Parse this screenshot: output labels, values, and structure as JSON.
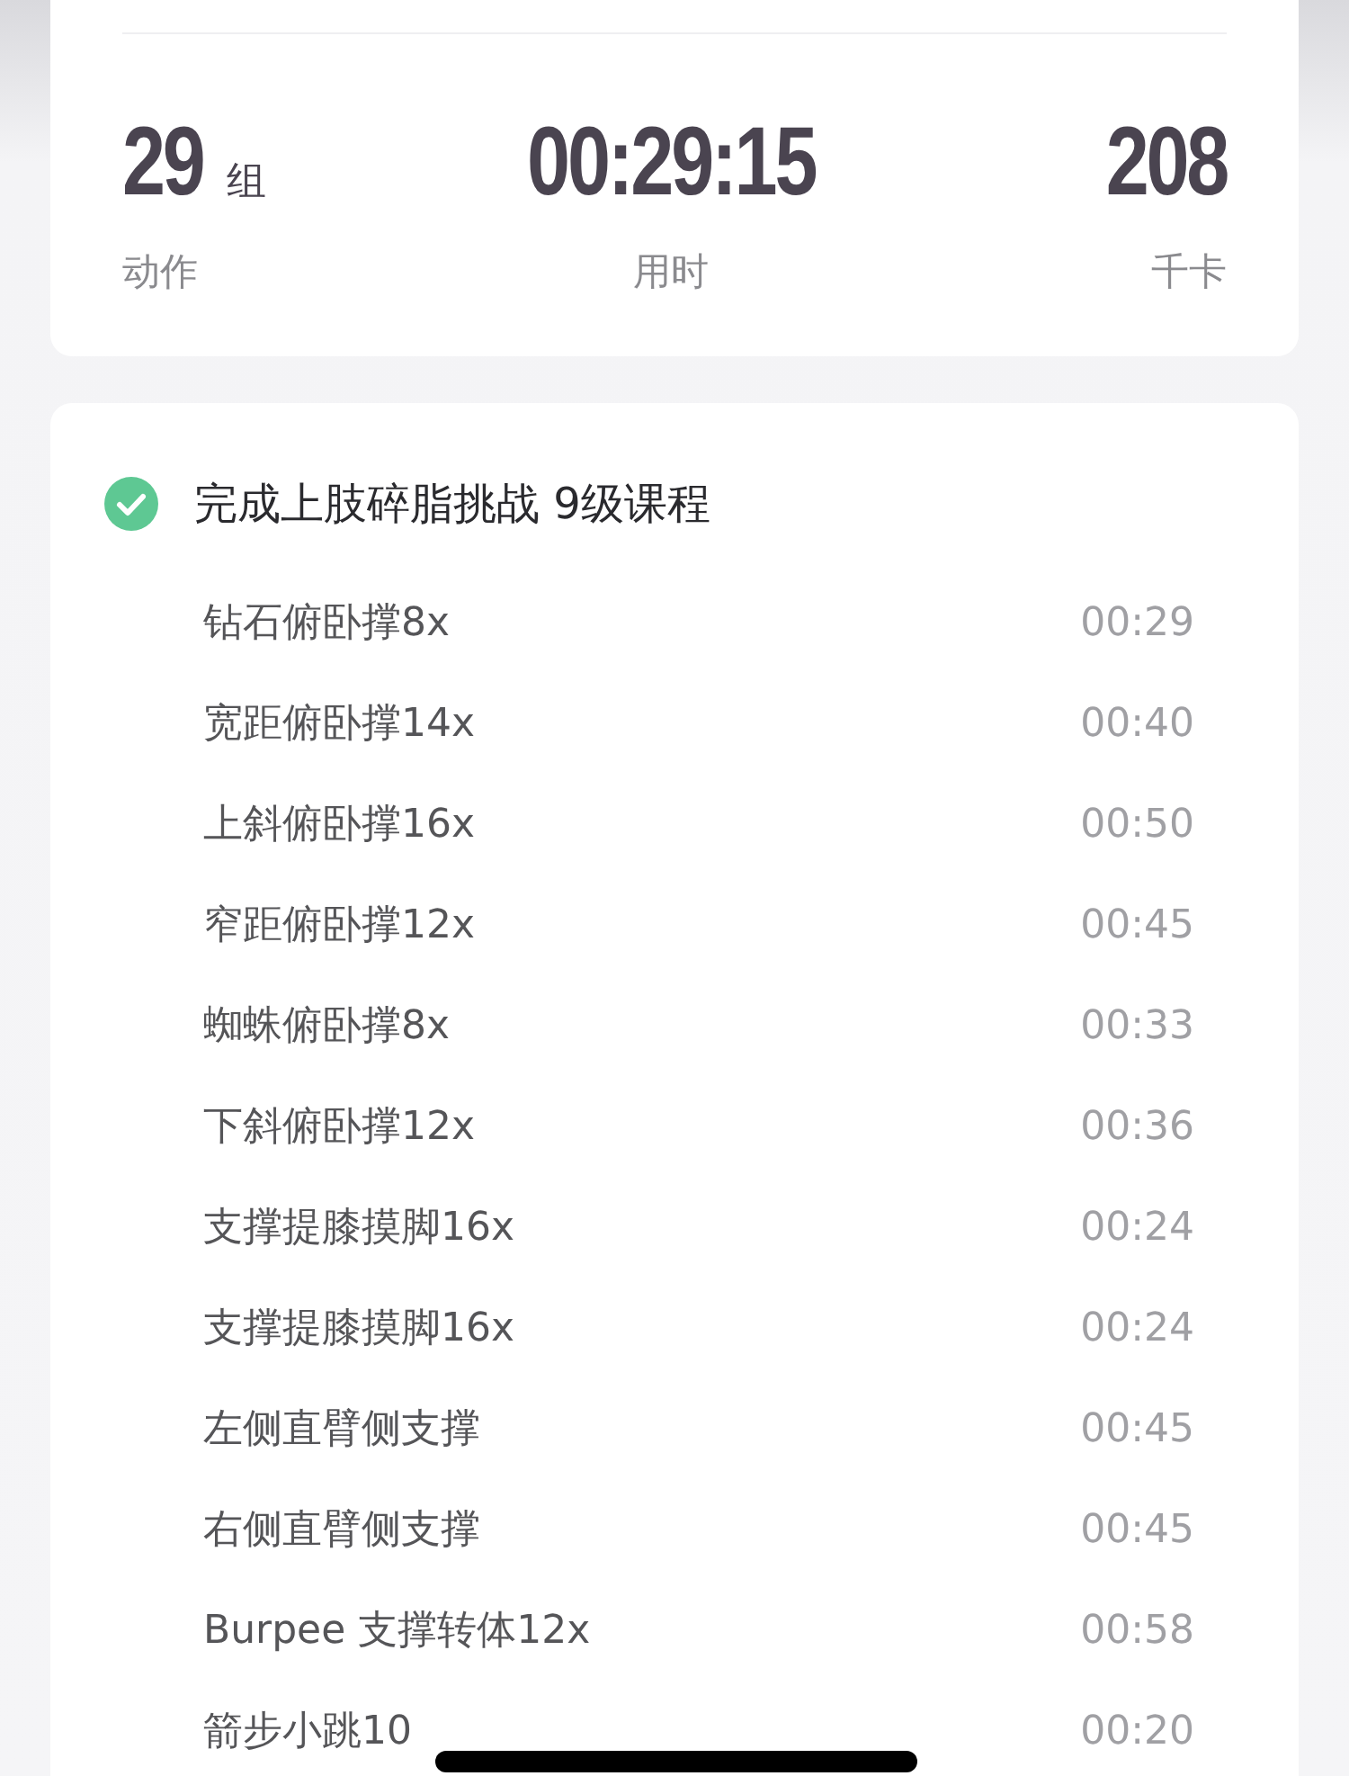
{
  "summary": {
    "stats": [
      {
        "value": "29",
        "unit": "组",
        "label": "动作"
      },
      {
        "value": "00:29:15",
        "label": "用时"
      },
      {
        "value": "208",
        "label": "千卡"
      }
    ]
  },
  "course": {
    "completed": true,
    "title": "完成上肢碎脂挑战 9级课程",
    "exercises": [
      {
        "name": "钻石俯卧撑8x",
        "time": "00:29"
      },
      {
        "name": "宽距俯卧撑14x",
        "time": "00:40"
      },
      {
        "name": "上斜俯卧撑16x",
        "time": "00:50"
      },
      {
        "name": "窄距俯卧撑12x",
        "time": "00:45"
      },
      {
        "name": "蜘蛛俯卧撑8x",
        "time": "00:33"
      },
      {
        "name": "下斜俯卧撑12x",
        "time": "00:36"
      },
      {
        "name": "支撑提膝摸脚16x",
        "time": "00:24"
      },
      {
        "name": "支撑提膝摸脚16x",
        "time": "00:24"
      },
      {
        "name": "左侧直臂侧支撑",
        "time": "00:45"
      },
      {
        "name": "右侧直臂侧支撑",
        "time": "00:45"
      },
      {
        "name": "Burpee 支撑转体12x",
        "time": "00:58"
      },
      {
        "name": "箭步小跳10",
        "time": "00:20"
      }
    ]
  }
}
